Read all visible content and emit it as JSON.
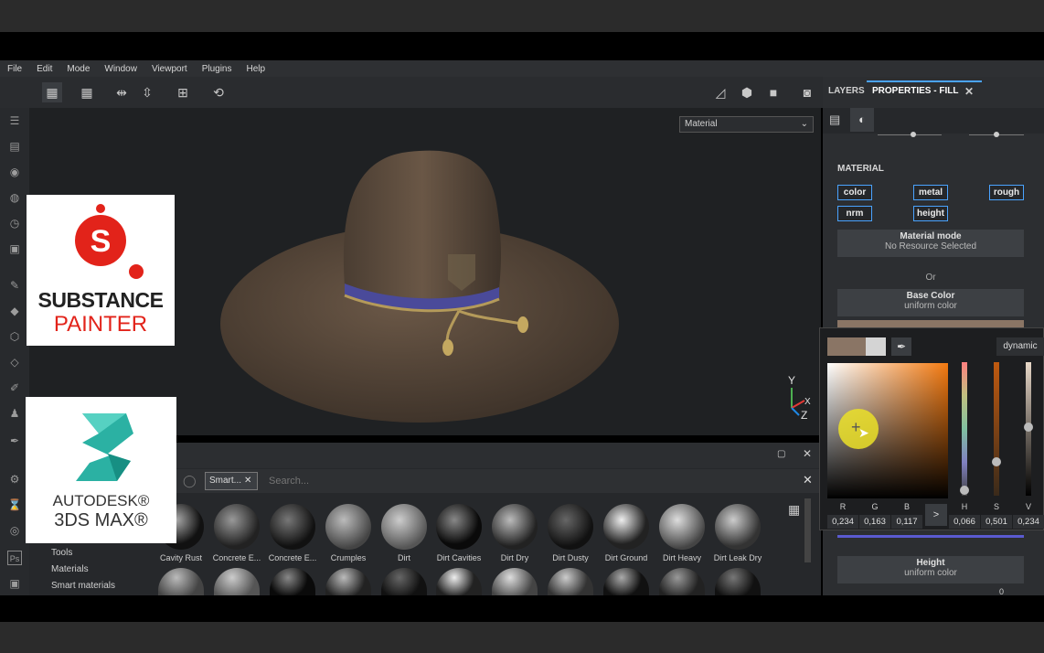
{
  "menu": [
    "File",
    "Edit",
    "Mode",
    "Window",
    "Viewport",
    "Plugins",
    "Help"
  ],
  "viewport": {
    "material_select": "Material",
    "axes": {
      "y": "Y",
      "x": "X",
      "z": "Z"
    }
  },
  "overlays": {
    "substance": {
      "line1": "SUBSTANCE",
      "line2": "PAINTER"
    },
    "max": {
      "line1": "AUTODESK®",
      "line2": "3DS MAX®"
    }
  },
  "shelf": {
    "tab": "Smart...",
    "search_placeholder": "Search...",
    "tree": [
      "Tools",
      "Materials",
      "Smart materials"
    ],
    "items": [
      "Cavity Rust",
      "Concrete E...",
      "Concrete E...",
      "Crumples",
      "Dirt",
      "Dirt Cavities",
      "Dirt Dry",
      "Dirt Dusty",
      "Dirt Ground",
      "Dirt Heavy",
      "Dirt Leak Dry"
    ]
  },
  "right_panel": {
    "tabs": {
      "layers": "LAYERS",
      "properties": "PROPERTIES - FILL"
    },
    "section": "MATERIAL",
    "channels": [
      "color",
      "metal",
      "rough",
      "nrm",
      "height"
    ],
    "material_mode": {
      "title": "Material mode",
      "value": "No Resource Selected"
    },
    "or": "Or",
    "base_color": {
      "title": "Base Color",
      "value": "uniform color"
    },
    "height": {
      "title": "Height",
      "value": "uniform color"
    },
    "height_value": "0"
  },
  "color_picker": {
    "mode": "dynamic",
    "labels": [
      "R",
      "G",
      "B",
      "H",
      "S",
      "V"
    ],
    "values": [
      "0,234",
      "0,163",
      "0,117",
      "0,066",
      "0,501",
      "0,234"
    ],
    "arrow": ">",
    "swatch_color": "#8a7565"
  }
}
